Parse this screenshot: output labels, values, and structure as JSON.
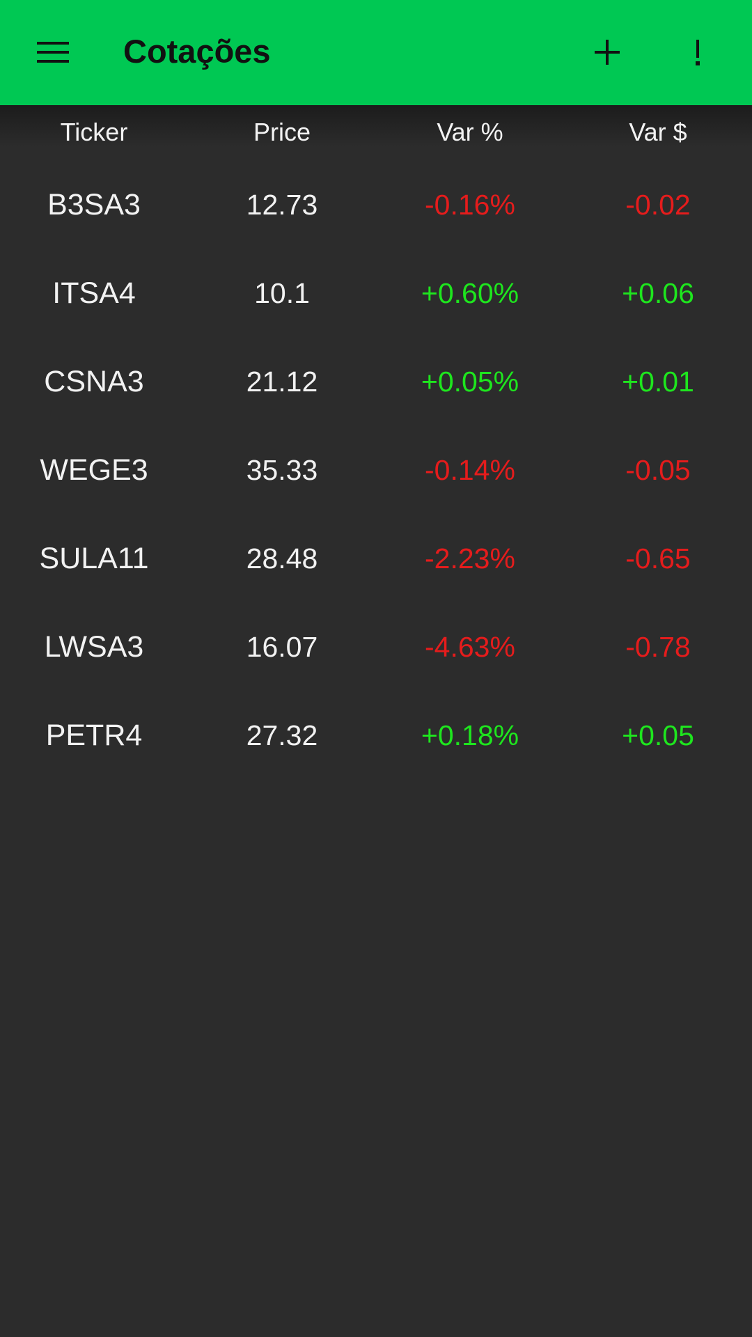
{
  "app_bar": {
    "title": "Cotações",
    "menu_icon": "menu-icon",
    "add_icon": "add-icon",
    "info_icon": "exclamation-icon",
    "color": "#00c853"
  },
  "table": {
    "headers": [
      "Ticker",
      "Price",
      "Var %",
      "Var $"
    ],
    "rows": [
      {
        "ticker": "B3SA3",
        "price": "12.73",
        "var_pct": "-0.16%",
        "var_abs": "-0.02",
        "direction": "down"
      },
      {
        "ticker": "ITSA4",
        "price": "10.1",
        "var_pct": "+0.60%",
        "var_abs": "+0.06",
        "direction": "up"
      },
      {
        "ticker": "CSNA3",
        "price": "21.12",
        "var_pct": "+0.05%",
        "var_abs": "+0.01",
        "direction": "up"
      },
      {
        "ticker": "WEGE3",
        "price": "35.33",
        "var_pct": "-0.14%",
        "var_abs": "-0.05",
        "direction": "down"
      },
      {
        "ticker": "SULA11",
        "price": "28.48",
        "var_pct": "-2.23%",
        "var_abs": "-0.65",
        "direction": "down"
      },
      {
        "ticker": "LWSA3",
        "price": "16.07",
        "var_pct": "-4.63%",
        "var_abs": "-0.78",
        "direction": "down"
      },
      {
        "ticker": "PETR4",
        "price": "27.32",
        "var_pct": "+0.18%",
        "var_abs": "+0.05",
        "direction": "up"
      }
    ]
  },
  "colors": {
    "background": "#2c2c2c",
    "negative": "#e51c1c",
    "positive": "#1ee61e"
  }
}
